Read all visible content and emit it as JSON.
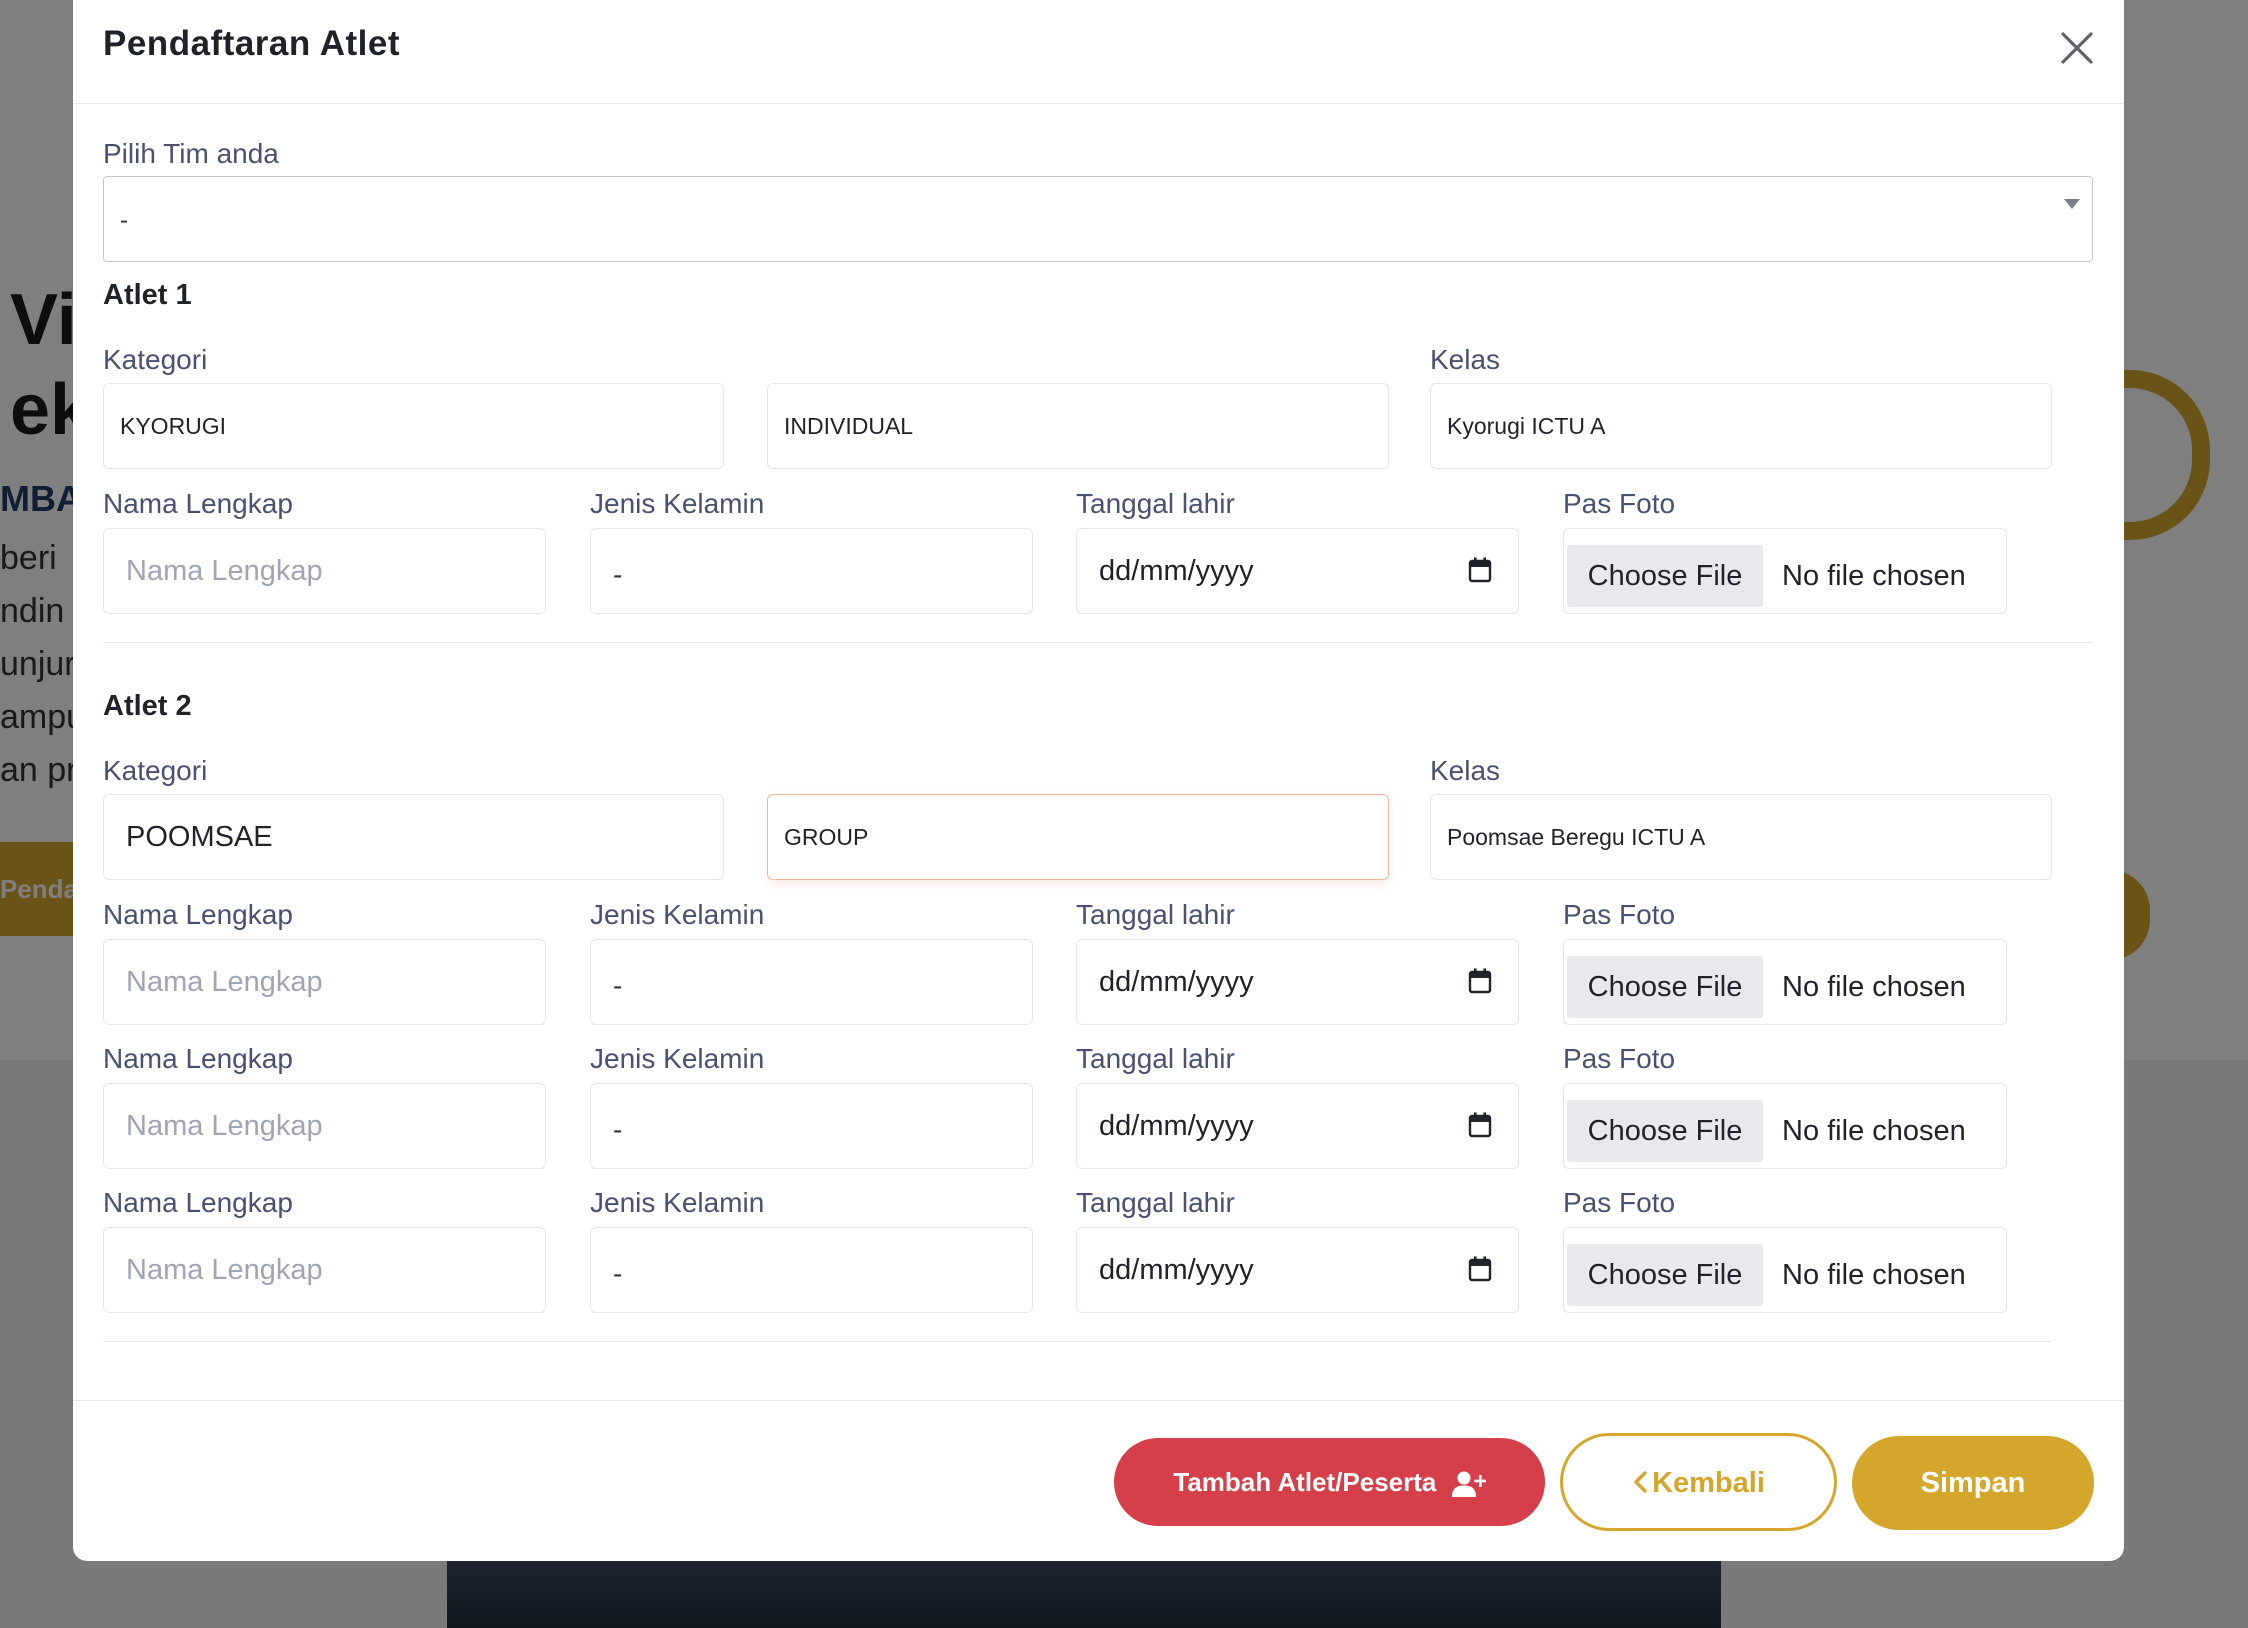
{
  "background": {
    "heading_lines": [
      "Vi",
      "ek"
    ],
    "subheading": "MBAN",
    "paragraph_lines": [
      "beri",
      "ndin",
      "unjur",
      "ampu",
      "an pr"
    ],
    "button_label": "Penda"
  },
  "modal": {
    "title": "Pendaftaran Atlet",
    "team": {
      "label": "Pilih Tim anda",
      "value": "-"
    },
    "athletes": [
      {
        "title": "Atlet 1",
        "kategori_label": "Kategori",
        "kategori": "KYORUGI",
        "tipe": "INDIVIDUAL",
        "kelas_label": "Kelas",
        "kelas": "Kyorugi ICTU A",
        "members": [
          {
            "nama_label": "Nama Lengkap",
            "nama_placeholder": "Nama Lengkap",
            "jk_label": "Jenis Kelamin",
            "jk_value": "-",
            "tgl_label": "Tanggal lahir",
            "tgl_value": "dd/mm/yyyy",
            "foto_label": "Pas Foto",
            "foto_button": "Choose File",
            "foto_status": "No file chosen"
          }
        ]
      },
      {
        "title": "Atlet 2",
        "kategori_label": "Kategori",
        "kategori": "POOMSAE",
        "tipe": "GROUP",
        "kelas_label": "Kelas",
        "kelas": "Poomsae Beregu ICTU A",
        "members": [
          {
            "nama_label": "Nama Lengkap",
            "nama_placeholder": "Nama Lengkap",
            "jk_label": "Jenis Kelamin",
            "jk_value": "-",
            "tgl_label": "Tanggal lahir",
            "tgl_value": "dd/mm/yyyy",
            "foto_label": "Pas Foto",
            "foto_button": "Choose File",
            "foto_status": "No file chosen"
          },
          {
            "nama_label": "Nama Lengkap",
            "nama_placeholder": "Nama Lengkap",
            "jk_label": "Jenis Kelamin",
            "jk_value": "-",
            "tgl_label": "Tanggal lahir",
            "tgl_value": "dd/mm/yyyy",
            "foto_label": "Pas Foto",
            "foto_button": "Choose File",
            "foto_status": "No file chosen"
          },
          {
            "nama_label": "Nama Lengkap",
            "nama_placeholder": "Nama Lengkap",
            "jk_label": "Jenis Kelamin",
            "jk_value": "-",
            "tgl_label": "Tanggal lahir",
            "tgl_value": "dd/mm/yyyy",
            "foto_label": "Pas Foto",
            "foto_button": "Choose File",
            "foto_status": "No file chosen"
          }
        ]
      }
    ],
    "footer": {
      "add_label": "Tambah Atlet/Peserta",
      "add_icon": "user-plus-icon",
      "back_label": "Kembali",
      "back_icon": "chevron-left-icon",
      "save_label": "Simpan"
    }
  },
  "colors": {
    "accent_gold": "#d4a72c",
    "danger_red": "#d43f4a",
    "label_text": "#4a5170"
  }
}
